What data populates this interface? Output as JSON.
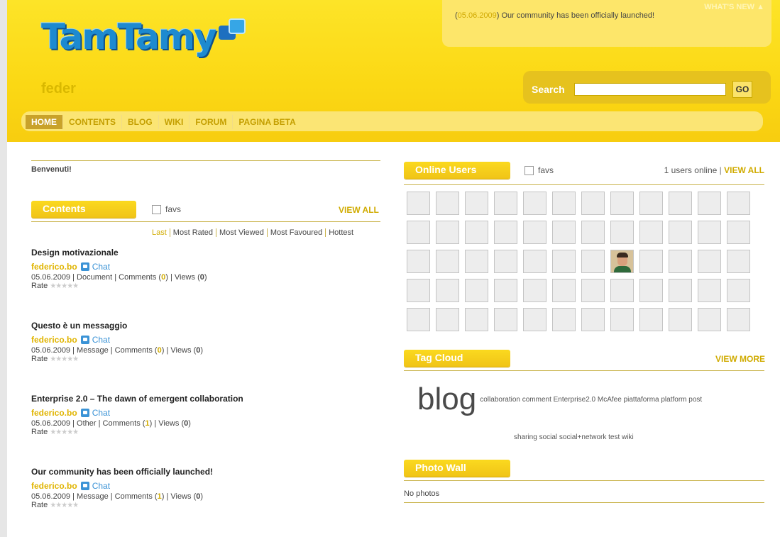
{
  "header": {
    "logo_text": "TamTamy",
    "username": "feder",
    "news": {
      "date": "05.06.2009",
      "text": "Our community has been officially launched!",
      "whats_new_label": "WHAT'S NEW ▲"
    },
    "search": {
      "label": "Search",
      "placeholder": "",
      "value": "",
      "go_label": "GO"
    },
    "nav": [
      "HOME",
      "CONTENTS",
      "BLOG",
      "WIKI",
      "FORUM",
      "PAGINA BETA"
    ],
    "active_nav": "HOME"
  },
  "left": {
    "welcome": "Benvenuti!",
    "contents_title": "Contents",
    "favs_label": "favs",
    "view_all": "VIEW ALL",
    "sort_links": [
      "Last",
      "Most Rated",
      "Most Viewed",
      "Most Favoured",
      "Hottest"
    ],
    "items": [
      {
        "title": "Design motivazionale",
        "author": "federico.bo",
        "chat": "Chat",
        "date": "05.06.2009",
        "type": "Document",
        "comments_label": "Comments",
        "comments": "0",
        "views_label": "Views",
        "views": "0",
        "rate_label": "Rate"
      },
      {
        "title": "Questo è un messaggio",
        "author": "federico.bo",
        "chat": "Chat",
        "date": "05.06.2009",
        "type": "Message",
        "comments_label": "Comments",
        "comments": "0",
        "views_label": "Views",
        "views": "0",
        "rate_label": "Rate"
      },
      {
        "title": "Enterprise 2.0 – The dawn of emergent collaboration",
        "author": "federico.bo",
        "chat": "Chat",
        "date": "05.06.2009",
        "type": "Other",
        "comments_label": "Comments",
        "comments": "1",
        "views_label": "Views",
        "views": "0",
        "rate_label": "Rate"
      },
      {
        "title": "Our community has been officially launched!",
        "author": "federico.bo",
        "chat": "Chat",
        "date": "05.06.2009",
        "type": "Message",
        "comments_label": "Comments",
        "comments": "1",
        "views_label": "Views",
        "views": "0",
        "rate_label": "Rate"
      }
    ]
  },
  "right": {
    "online_title": "Online Users",
    "favs_label": "favs",
    "users_online": "1 users online",
    "view_all": "VIEW ALL",
    "tagcloud_title": "Tag Cloud",
    "view_more": "VIEW MORE",
    "tag_big": "blog",
    "tags_line1": "collaboration comment Enterprise2.0 McAfee piattaforma platform post",
    "tags_line2": "sharing social social+network test wiki",
    "photowall_title": "Photo Wall",
    "no_photos": "No photos"
  },
  "colors": {
    "header_yellow": "#fbd814",
    "accent_gold": "#d0ab00",
    "chat_blue": "#3b93d6",
    "logo_blue": "#1d8ad0"
  }
}
